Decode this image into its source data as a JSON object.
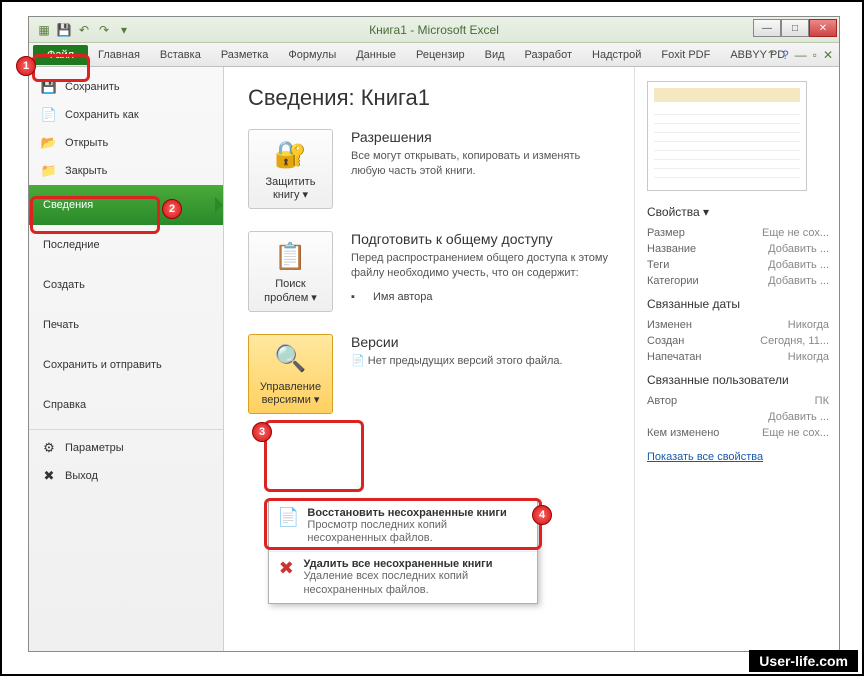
{
  "title": "Книга1  -  Microsoft Excel",
  "tabs": {
    "file": "Файл",
    "t1": "Главная",
    "t2": "Вставка",
    "t3": "Разметка",
    "t4": "Формулы",
    "t5": "Данные",
    "t6": "Рецензир",
    "t7": "Вид",
    "t8": "Разработ",
    "t9": "Надстрой",
    "t10": "Foxit PDF",
    "t11": "ABBYY PD"
  },
  "sidebar": {
    "save": "Сохранить",
    "saveas": "Сохранить как",
    "open": "Открыть",
    "close": "Закрыть",
    "info": "Сведения",
    "recent": "Последние",
    "new": "Создать",
    "print": "Печать",
    "share": "Сохранить и отправить",
    "help": "Справка",
    "options": "Параметры",
    "exit": "Выход"
  },
  "heading": "Сведения: Книга1",
  "perm": {
    "btn": "Защитить книгу ▾",
    "title": "Разрешения",
    "text": "Все могут открывать, копировать и изменять любую часть этой книги."
  },
  "prep": {
    "btn": "Поиск проблем ▾",
    "title": "Подготовить к общему доступу",
    "text": "Перед распространением общего доступа к этому файлу необходимо учесть, что он содержит:",
    "bullet": "Имя автора"
  },
  "vers": {
    "btn": "Управление версиями ▾",
    "title": "Версии",
    "text": "Нет предыдущих версий этого файла."
  },
  "dd": {
    "r1t": "Восстановить несохраненные книги",
    "r1d": "Просмотр последних копий несохраненных файлов.",
    "r2t": "Удалить все несохраненные книги",
    "r2d": "Удаление всех последних копий несохраненных файлов."
  },
  "props": {
    "h": "Свойства ▾",
    "size_k": "Размер",
    "size_v": "Еще не сох...",
    "title_k": "Название",
    "title_v": "Добавить ...",
    "tags_k": "Теги",
    "tags_v": "Добавить ...",
    "cat_k": "Категории",
    "cat_v": "Добавить ...",
    "dates_h": "Связанные даты",
    "mod_k": "Изменен",
    "mod_v": "Никогда",
    "cr_k": "Создан",
    "cr_v": "Сегодня, 11...",
    "pr_k": "Напечатан",
    "pr_v": "Никогда",
    "users_h": "Связанные пользователи",
    "auth_k": "Автор",
    "auth_v": "ПК",
    "authadd": "Добавить ...",
    "chg_k": "Кем изменено",
    "chg_v": "Еще не сох...",
    "link": "Показать все свойства"
  },
  "watermark": "User-life.com",
  "badges": {
    "b1": "1",
    "b2": "2",
    "b3": "3",
    "b4": "4"
  }
}
